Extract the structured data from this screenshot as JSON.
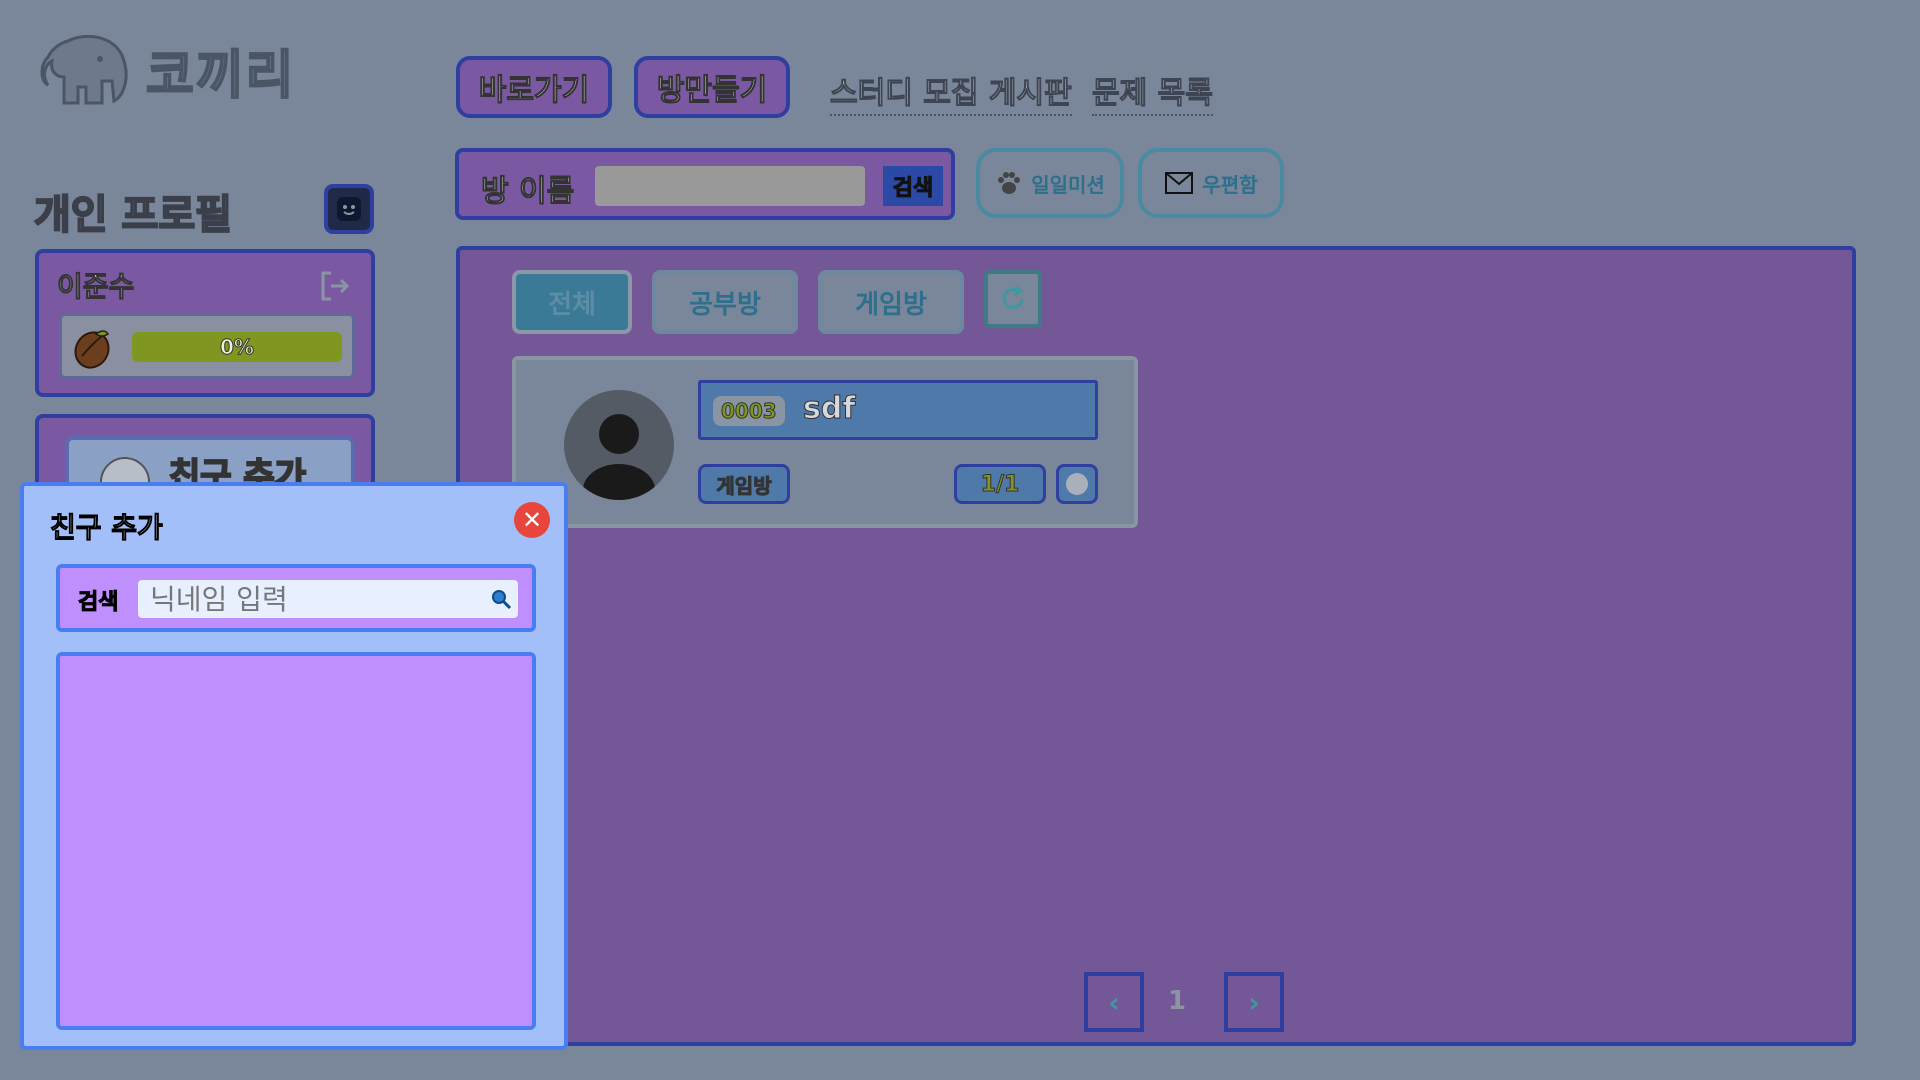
{
  "brand": {
    "name": "코끼리",
    "logo_icon": "elephant-icon"
  },
  "nav": {
    "shortcut_label": "바로가기",
    "create_room_label": "방만들기",
    "study_board_label": "스터디 모집 게시판",
    "problems_label": "문제 목록"
  },
  "profile": {
    "title": "개인 프로필",
    "name": "이준수",
    "progress_text": "0%",
    "progress_value": 0,
    "friend_add_label": "친구 추가"
  },
  "room_search": {
    "label": "방 이름",
    "value": "",
    "button": "검색"
  },
  "aux": {
    "daily_mission": "일일미션",
    "mailbox": "우편함"
  },
  "tabs": [
    "전체",
    "공부방",
    "게임방"
  ],
  "rooms": [
    {
      "id": "0003",
      "name": "sdf",
      "type": "게임방",
      "count": "1/1"
    }
  ],
  "pagination": {
    "current": "1"
  },
  "modal": {
    "title": "친구 추가",
    "search_label": "검색",
    "search_placeholder": "닉네임 입력"
  },
  "colors": {
    "panel": "#745797",
    "border": "#2f3fa0",
    "modal_bg": "#a3bffa",
    "modal_list": "#c08ffe",
    "close": "#e8453c"
  }
}
